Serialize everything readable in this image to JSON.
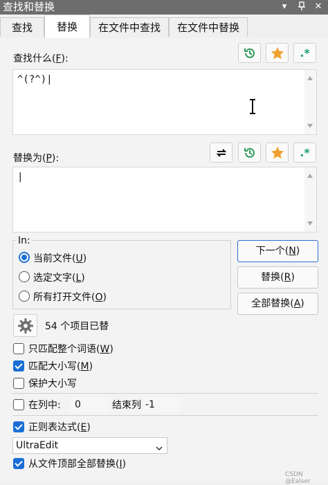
{
  "titlebar": {
    "title": "查找和替换",
    "minimize_glyph": "▾",
    "pin_glyph": "ᒧ",
    "close_glyph": "✕"
  },
  "tabs": [
    {
      "label": "查找"
    },
    {
      "label": "替换"
    },
    {
      "label": "在文件中查找"
    },
    {
      "label": "在文件中替换"
    }
  ],
  "find": {
    "label_prefix": "查找什么(",
    "label_key": "F",
    "label_suffix": "):",
    "value": "^(?^)|",
    "icons": [
      "history-icon",
      "star-icon",
      "regex-icon"
    ],
    "regex_glyph": ".*"
  },
  "replace": {
    "label_prefix": "替换为(",
    "label_key": "P",
    "label_suffix": "):",
    "value": "|",
    "icons": [
      "swap-icon",
      "history-icon",
      "star-icon",
      "regex-icon"
    ],
    "regex_glyph": ".*"
  },
  "scope": {
    "legend": "In:",
    "options": [
      {
        "prefix": "当前文件(",
        "key": "U",
        "suffix": ")",
        "selected": true
      },
      {
        "prefix": "选定文字(",
        "key": "L",
        "suffix": ")",
        "selected": false
      },
      {
        "prefix": "所有打开文件(",
        "key": "O",
        "suffix": ")",
        "selected": false
      }
    ]
  },
  "actions": {
    "next": {
      "prefix": "下一个(",
      "key": "N",
      "suffix": ")"
    },
    "replace": {
      "prefix": "替换(",
      "key": "R",
      "suffix": ")"
    },
    "replace_all": {
      "prefix": "全部替换(",
      "key": "A",
      "suffix": ")"
    }
  },
  "status": {
    "text": "54 个项目已替"
  },
  "options": [
    {
      "prefix": "只匹配整个词语(",
      "key": "W",
      "suffix": ")",
      "checked": false
    },
    {
      "prefix": "匹配大小写(",
      "key": "M",
      "suffix": ")",
      "checked": true
    },
    {
      "prefix": "保护大小写",
      "key": "",
      "suffix": "",
      "checked": false
    }
  ],
  "column": {
    "label": "在列中:",
    "start_value": "0",
    "end_label": "结束列",
    "end_value": "-1",
    "checked": false
  },
  "regex": {
    "prefix": "正则表达式(",
    "key": "E",
    "suffix": ")",
    "checked": true
  },
  "engine": {
    "selected": "UltraEdit"
  },
  "from_top": {
    "prefix": "从文件顶部全部替换(",
    "key": "I",
    "suffix": ")",
    "checked": true
  },
  "watermark": "CSDN @Ealser",
  "colors": {
    "accent": "#1a6fd6",
    "history_green": "#2e9a5b",
    "star_orange": "#f0a030",
    "regex_green": "#1aa06a"
  }
}
